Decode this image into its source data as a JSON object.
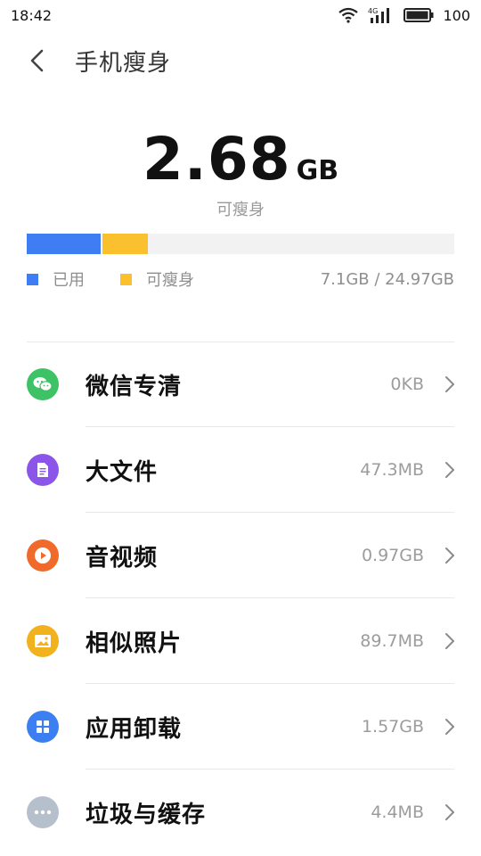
{
  "status_bar": {
    "time": "18:42",
    "network_label": "4G",
    "battery_level": "100"
  },
  "header": {
    "title": "手机瘦身"
  },
  "summary": {
    "value": "2.68",
    "unit": "GB",
    "caption": "可瘦身"
  },
  "storage": {
    "used_fraction": 0.173,
    "slimmable_fraction": 0.107,
    "used_color": "#3f7ef2",
    "slimmable_color": "#fbc02d",
    "legend_used": "已用",
    "legend_slimmable": "可瘦身",
    "total_text": "7.1GB / 24.97GB"
  },
  "items": [
    {
      "label": "微信专清",
      "size": "0KB",
      "icon": "wechat-icon",
      "color": "#3ec266"
    },
    {
      "label": "大文件",
      "size": "47.3MB",
      "icon": "document-icon",
      "color": "#8a55e8"
    },
    {
      "label": "音视频",
      "size": "0.97GB",
      "icon": "play-icon",
      "color": "#f06a2b"
    },
    {
      "label": "相似照片",
      "size": "89.7MB",
      "icon": "photo-icon",
      "color": "#f1b21e"
    },
    {
      "label": "应用卸载",
      "size": "1.57GB",
      "icon": "apps-grid-icon",
      "color": "#3c7ff0"
    },
    {
      "label": "垃圾与缓存",
      "size": "4.4MB",
      "icon": "more-dots-icon",
      "color": "#b6c0cc"
    }
  ]
}
